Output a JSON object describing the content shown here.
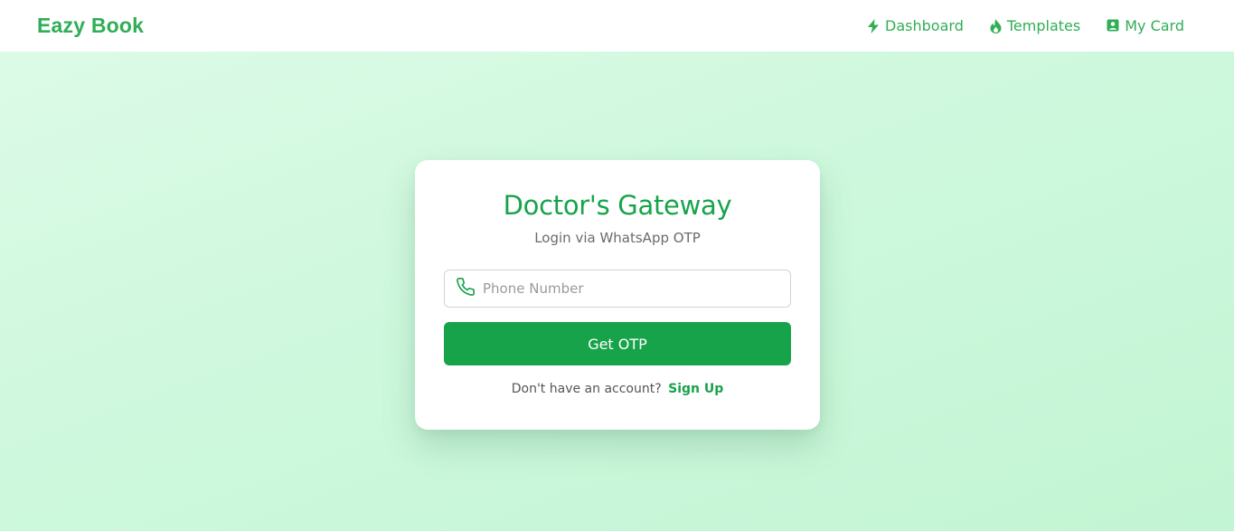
{
  "brand": {
    "name": "Eazy Book"
  },
  "nav": {
    "items": [
      {
        "label": "Dashboard",
        "icon": "bolt-icon"
      },
      {
        "label": "Templates",
        "icon": "flame-icon"
      },
      {
        "label": "My Card",
        "icon": "contact-card-icon"
      }
    ]
  },
  "login": {
    "title": "Doctor's Gateway",
    "subtitle": "Login via WhatsApp OTP",
    "phone_placeholder": "Phone Number",
    "phone_value": "",
    "phone_icon": "phone-icon",
    "submit_label": "Get OTP",
    "signup_prompt": "Don't have an account?",
    "signup_link": "Sign Up"
  },
  "colors": {
    "accent": "#17a34a",
    "nav_accent": "#2fae55",
    "background_start": "#dcfbe7",
    "background_end": "#c2f5d3"
  }
}
